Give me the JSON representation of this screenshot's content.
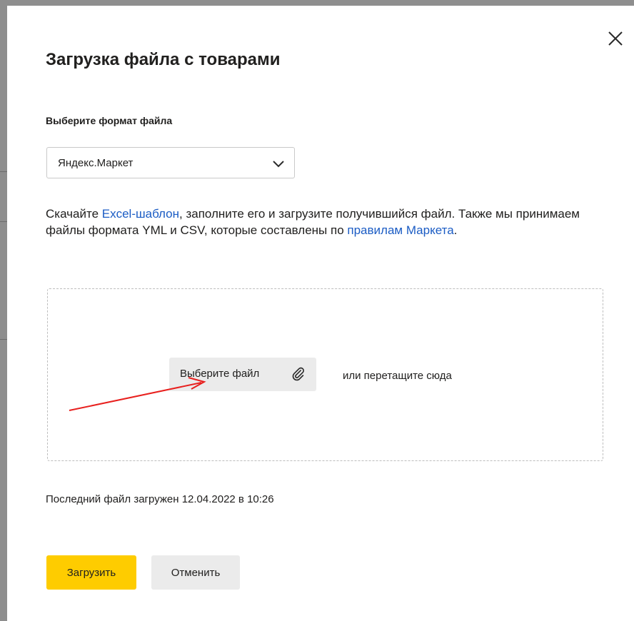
{
  "modal": {
    "title": "Загрузка файла с товарами",
    "close_icon": "close-icon"
  },
  "format": {
    "label": "Выберите формат файла",
    "selected": "Яндекс.Маркет",
    "chevron_icon": "chevron-down-icon"
  },
  "description": {
    "part1": "Скачайте ",
    "template_link": "Excel-шаблон",
    "part2": ", заполните его и загрузите получившийся файл. Также мы принимаем файлы формата YML и CSV, которые составлены по ",
    "rules_link": "правилам Маркета",
    "part3": "."
  },
  "dropzone": {
    "choose_button": "Выберите файл",
    "clip_icon": "paperclip-icon",
    "drag_hint": "или перетащите сюда"
  },
  "annotation": {
    "arrow_color": "#e8201e"
  },
  "status": {
    "last_file": "Последний файл загружен 12.04.2022 в 10:26"
  },
  "actions": {
    "upload": "Загрузить",
    "cancel": "Отменить"
  },
  "colors": {
    "accent": "#fecc00",
    "link": "#1b5cc4",
    "secondary_button": "#ebebeb"
  }
}
